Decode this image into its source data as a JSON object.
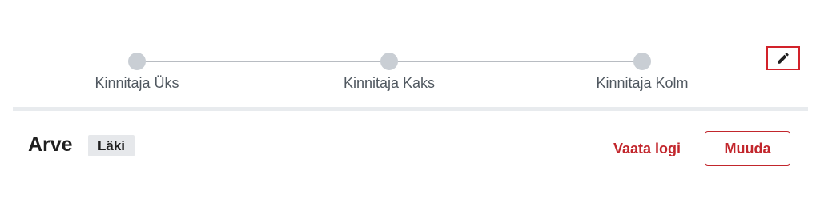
{
  "stepper": {
    "steps": [
      {
        "label": "Kinnitaja Üks"
      },
      {
        "label": "Kinnitaja Kaks"
      },
      {
        "label": "Kinnitaja Kolm"
      }
    ],
    "edit_icon": "pencil-icon"
  },
  "header": {
    "title": "Arve",
    "badge": "Läki",
    "log_link": "Vaata logi",
    "change_button": "Muuda"
  },
  "colors": {
    "accent": "#c2262c",
    "step_dot": "#c9ced4",
    "badge_bg": "#e6e8eb"
  }
}
